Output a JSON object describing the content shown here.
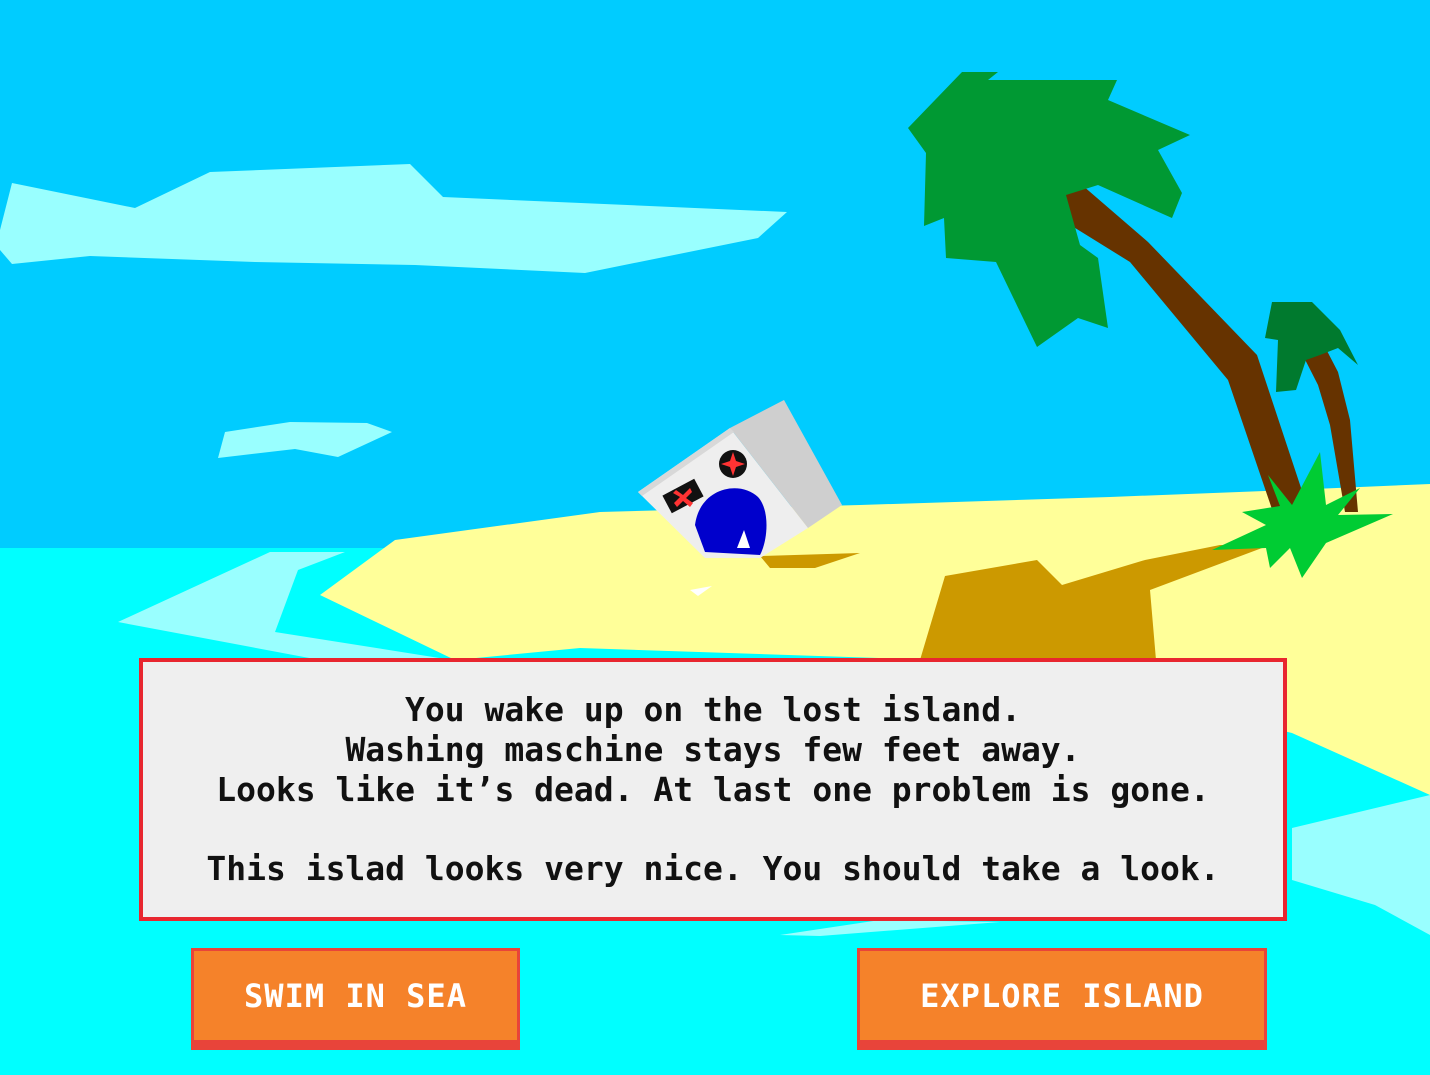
{
  "scene": {
    "sky_color": "#00ccff",
    "sea_color": "#00ffff",
    "foam_color": "#99ffff",
    "sand_color": "#ffff99",
    "shadow_color": "#cc9900",
    "palm_trunk_color": "#663300",
    "palm_leaf_color": "#009933",
    "small_palm_leaf_color": "#007a2e",
    "bush_color": "#00cc33",
    "washing_machine": {
      "body_color": "#eeeeee",
      "door_color": "#0000cc",
      "indicator_color": "#ff3333"
    }
  },
  "dialog": {
    "lines": [
      "You wake up on the lost island.",
      "Washing maschine stays few feet away.",
      "Looks like it’s dead. At last one problem is gone."
    ],
    "hint": "This islad looks very nice. You should take a look."
  },
  "buttons": {
    "swim_label": "SWIM IN SEA",
    "explore_label": "EXPLORE ISLAND"
  }
}
